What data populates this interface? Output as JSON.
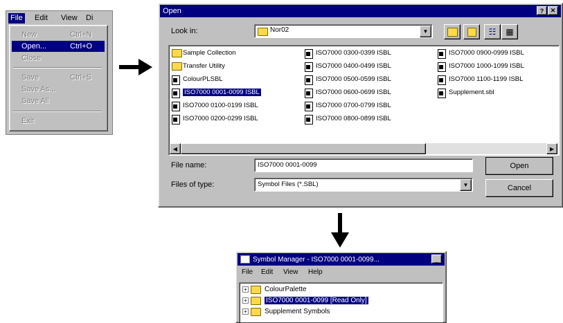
{
  "menu": {
    "menubar": [
      "File",
      "Edit",
      "View",
      "Di"
    ],
    "items": [
      {
        "label": "New",
        "shortcut": "Ctrl+N"
      },
      {
        "label": "Open...",
        "shortcut": "Ctrl+O"
      },
      {
        "label": "Close",
        "shortcut": ""
      },
      {
        "label": "Save",
        "shortcut": "Ctrl+S"
      },
      {
        "label": "Save As...",
        "shortcut": ""
      },
      {
        "label": "Save All",
        "shortcut": ""
      },
      {
        "label": "Exit",
        "shortcut": ""
      }
    ]
  },
  "open_dialog": {
    "title": "Open",
    "look_in_label": "Look in:",
    "look_in_value": "Nor02",
    "files_col1": [
      {
        "name": "Sample Collection",
        "type": "folder"
      },
      {
        "name": "Transfer Utility",
        "type": "folder"
      },
      {
        "name": "ColourPLSBL",
        "type": "file"
      },
      {
        "name": "ISO7000  0001-0099 ISBL",
        "type": "file",
        "selected": true
      },
      {
        "name": "ISO7000  0100-0199 ISBL",
        "type": "file"
      },
      {
        "name": "ISO7000  0200-0299 ISBL",
        "type": "file"
      }
    ],
    "files_col2": [
      {
        "name": "ISO7000  0300-0399 ISBL",
        "type": "file"
      },
      {
        "name": "ISO7000  0400-0499 ISBL",
        "type": "file"
      },
      {
        "name": "ISO7000  0500-0599 ISBL",
        "type": "file"
      },
      {
        "name": "ISO7000  0600-0699 ISBL",
        "type": "file"
      },
      {
        "name": "ISO7000  0700-0799 ISBL",
        "type": "file"
      },
      {
        "name": "ISO7000  0800-0899 ISBL",
        "type": "file"
      }
    ],
    "files_col3": [
      {
        "name": "ISO7000  0900-0999 ISBL",
        "type": "file"
      },
      {
        "name": "ISO7000  1000-1099 ISBL",
        "type": "file"
      },
      {
        "name": "ISO7000  1100-1199 ISBL",
        "type": "file"
      },
      {
        "name": "Supplement.sbl",
        "type": "file"
      }
    ],
    "file_name_label": "File name:",
    "file_name_value": "ISO7000  0001-0099",
    "files_of_type_label": "Files of type:",
    "files_of_type_value": "Symbol Files (*.SBL)",
    "open_button": "Open",
    "cancel_button": "Cancel"
  },
  "symbol_manager": {
    "title": "Symbol Manager - ISO7000  0001-0099...",
    "menubar": [
      "File",
      "Edit",
      "View",
      "Help"
    ],
    "tree": [
      {
        "label": "ColourPalette"
      },
      {
        "label": "ISO7000  0001-0099 [Read Only]",
        "selected": true
      },
      {
        "label": "Supplement Symbols"
      }
    ]
  },
  "colors": {
    "titlebar": "#000080",
    "face": "#c0c0c0",
    "selection": "#000080",
    "folder": "#ffd94a"
  }
}
